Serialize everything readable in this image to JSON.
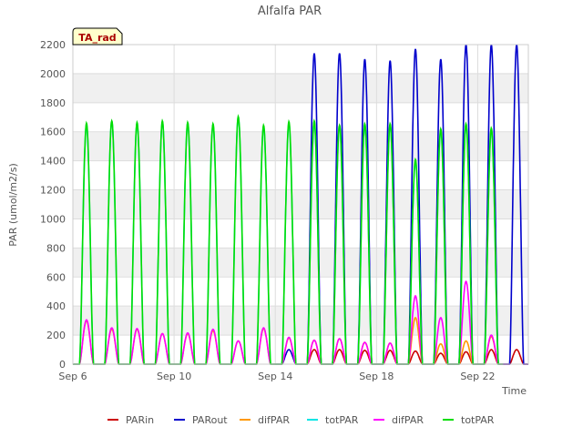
{
  "chart_data": {
    "type": "line",
    "title": "Alfalfa PAR",
    "xlabel": "Time",
    "ylabel": "PAR (umol/m2/s)",
    "xlim": [
      "2023-09-06",
      "2023-09-24"
    ],
    "ylim": [
      0,
      2200
    ],
    "yticks": [
      0,
      200,
      400,
      600,
      800,
      1000,
      1200,
      1400,
      1600,
      1800,
      2000,
      2200
    ],
    "xticks": [
      {
        "date": "2023-09-06",
        "label": "Sep 6"
      },
      {
        "date": "2023-09-10",
        "label": "Sep 10"
      },
      {
        "date": "2023-09-14",
        "label": "Sep 14"
      },
      {
        "date": "2023-09-18",
        "label": "Sep 18"
      },
      {
        "date": "2023-09-22",
        "label": "Sep 22"
      }
    ],
    "grid": true,
    "background_bands": true,
    "legend_position": "bottom",
    "annotation": {
      "text": "TA_rad",
      "bg": "#ffffcc",
      "color": "#aa0000"
    },
    "days": [
      "2023-09-06",
      "2023-09-07",
      "2023-09-08",
      "2023-09-09",
      "2023-09-10",
      "2023-09-11",
      "2023-09-12",
      "2023-09-13",
      "2023-09-14",
      "2023-09-15",
      "2023-09-16",
      "2023-09-17",
      "2023-09-18",
      "2023-09-19",
      "2023-09-20",
      "2023-09-21",
      "2023-09-22",
      "2023-09-23"
    ],
    "series": [
      {
        "name": "PARin",
        "color": "#cc0000",
        "daily_peak": [
          null,
          null,
          null,
          null,
          null,
          null,
          null,
          null,
          null,
          100,
          100,
          95,
          95,
          90,
          75,
          85,
          100,
          100
        ]
      },
      {
        "name": "PARout",
        "color": "#0000cc",
        "daily_peak": [
          null,
          null,
          null,
          null,
          null,
          null,
          null,
          null,
          100,
          2140,
          2140,
          2100,
          2090,
          2170,
          2100,
          2200,
          2200,
          2200
        ]
      },
      {
        "name": "difPAR",
        "color": "#ff9900",
        "daily_peak": [
          300,
          240,
          240,
          210,
          210,
          230,
          160,
          245,
          180,
          165,
          175,
          150,
          145,
          320,
          140,
          160,
          190,
          null
        ]
      },
      {
        "name": "totPAR",
        "color": "#00e5e5",
        "daily_peak": [
          1650,
          1670,
          1660,
          1670,
          1660,
          1650,
          1700,
          1640,
          1660,
          1670,
          1640,
          1650,
          1650,
          1400,
          1610,
          1650,
          1620,
          null
        ]
      },
      {
        "name": "difPAR",
        "color": "#ff00ff",
        "daily_peak": [
          305,
          250,
          245,
          210,
          215,
          240,
          160,
          250,
          185,
          165,
          175,
          150,
          145,
          470,
          320,
          570,
          200,
          null
        ]
      },
      {
        "name": "totPAR",
        "color": "#00dd00",
        "daily_peak": [
          1660,
          1675,
          1665,
          1675,
          1665,
          1655,
          1705,
          1645,
          1670,
          1675,
          1645,
          1655,
          1655,
          1410,
          1620,
          1655,
          1625,
          null
        ]
      }
    ]
  }
}
